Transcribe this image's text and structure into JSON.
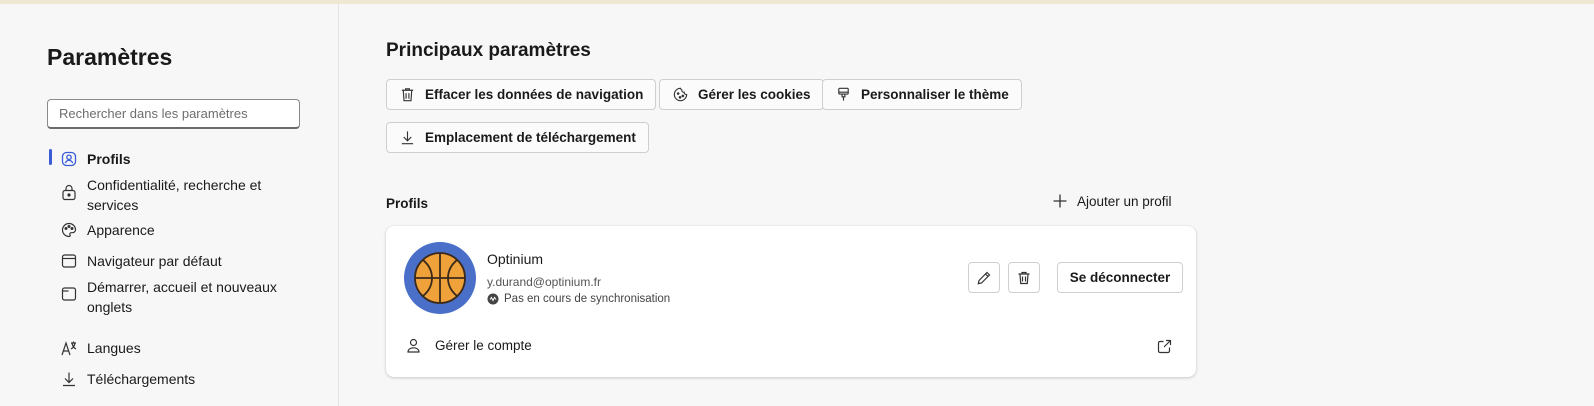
{
  "colors": {
    "accent": "#3a5cd6",
    "avatar_bg": "#4a6fc9",
    "ball": "#f0a23a"
  },
  "sidebar": {
    "title": "Paramètres",
    "search_placeholder": "Rechercher dans les paramètres",
    "items": [
      {
        "label": "Profils",
        "icon": "profile-icon",
        "active": true
      },
      {
        "label": "Confidentialité, recherche et services",
        "icon": "lock-icon"
      },
      {
        "label": "Apparence",
        "icon": "palette-icon"
      },
      {
        "label": "Navigateur par défaut",
        "icon": "browser-icon"
      },
      {
        "label": "Démarrer, accueil et nouveaux onglets",
        "icon": "start-page-icon"
      },
      {
        "label": "Langues",
        "icon": "language-icon"
      },
      {
        "label": "Téléchargements",
        "icon": "download-icon"
      }
    ]
  },
  "main": {
    "title": "Principaux paramètres",
    "quick_actions": [
      {
        "label": "Effacer les données de navigation",
        "icon": "trash-icon"
      },
      {
        "label": "Gérer les cookies",
        "icon": "cookie-icon"
      },
      {
        "label": "Personnaliser le thème",
        "icon": "brush-icon"
      },
      {
        "label": "Emplacement de téléchargement",
        "icon": "download-icon"
      }
    ],
    "profiles": {
      "section_label": "Profils",
      "add_label": "Ajouter un profil",
      "card": {
        "name": "Optinium",
        "email": "y.durand@optinium.fr",
        "sync_status": "Pas en cours de synchronisation",
        "signout_label": "Se déconnecter",
        "manage_label": "Gérer le compte"
      }
    }
  }
}
